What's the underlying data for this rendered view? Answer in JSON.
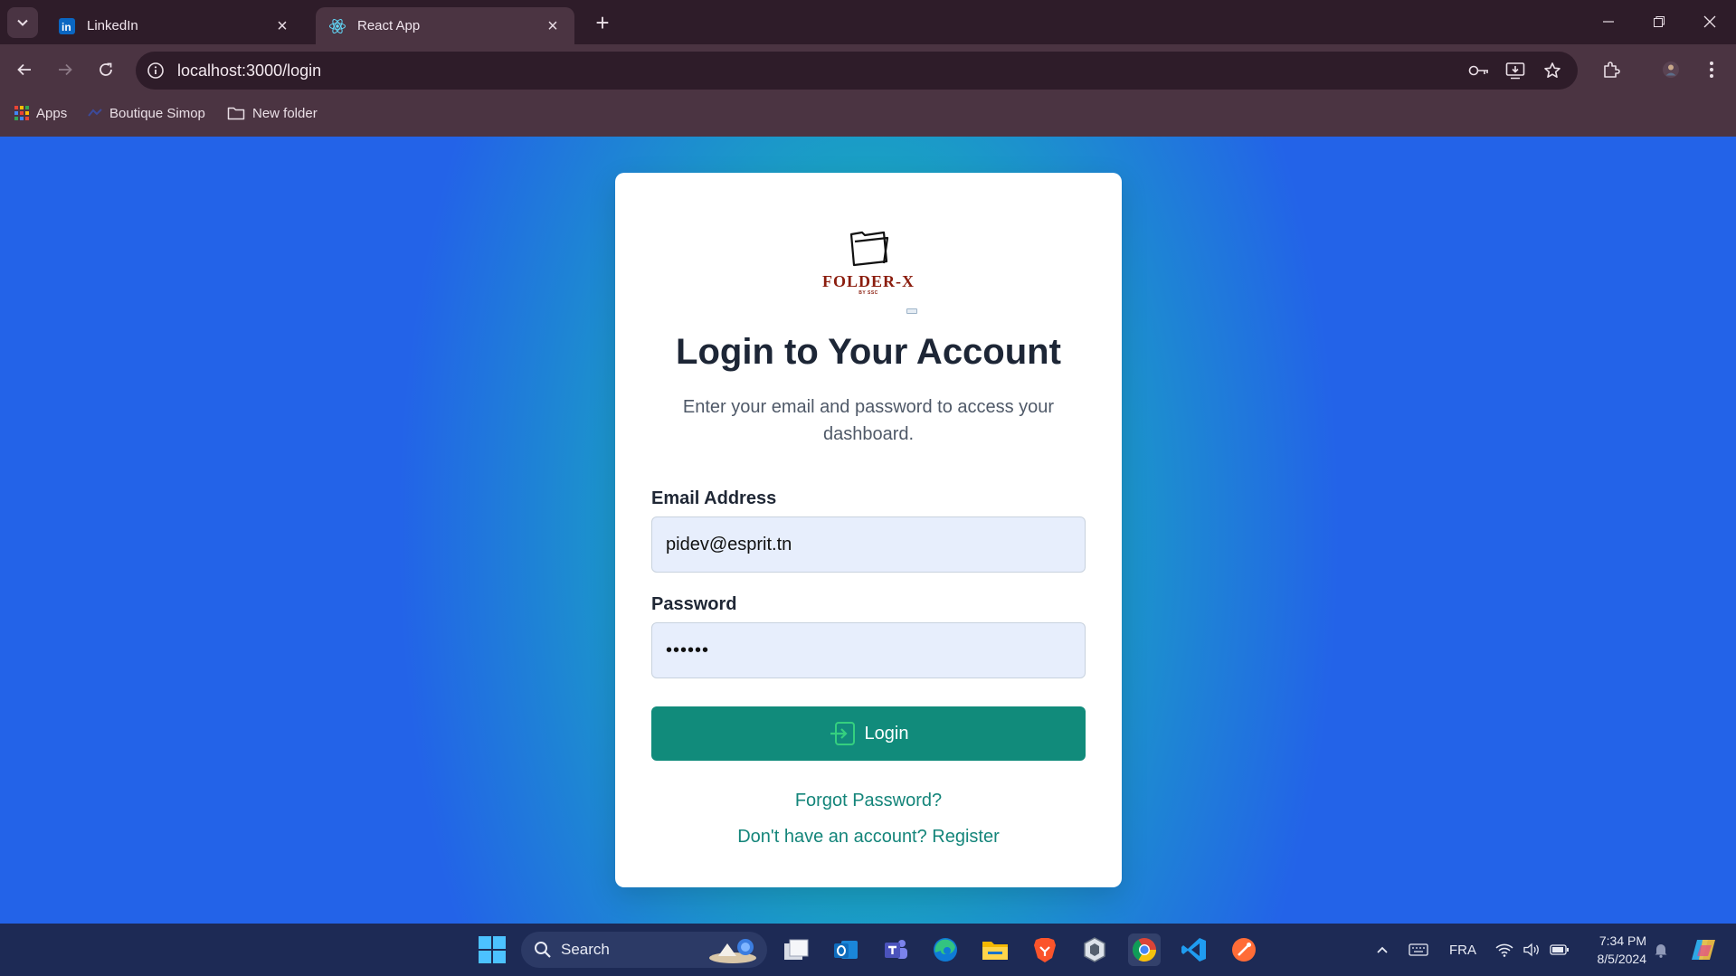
{
  "browser": {
    "tabs": [
      {
        "title": "LinkedIn",
        "icon": "linkedin-icon",
        "active": false
      },
      {
        "title": "React App",
        "icon": "react-icon",
        "active": true
      }
    ],
    "url": "localhost:3000/login",
    "bookmarks": [
      {
        "label": "Apps",
        "icon": "apps-grid-icon"
      },
      {
        "label": "Boutique Simop",
        "icon": "site-favicon-icon"
      },
      {
        "label": "New folder",
        "icon": "folder-icon"
      }
    ],
    "colors": {
      "tabstrip": "#2e1c29",
      "toolbar": "#4b3442"
    }
  },
  "login": {
    "logo_text": "FOLDER-X",
    "logo_subtext": "BY SSC",
    "title": "Login to Your Account",
    "subtitle": "Enter your email and password to access your dashboard.",
    "email_label": "Email Address",
    "email_value": "pidev@esprit.tn",
    "password_label": "Password",
    "password_value": "••••••",
    "login_button": "Login",
    "forgot_link": "Forgot Password?",
    "register_link": "Don't have an account? Register",
    "colors": {
      "button": "#118b7b",
      "link": "#14857a",
      "field_bg": "#e7eefc"
    }
  },
  "taskbar": {
    "search_label": "Search",
    "language": "FRA",
    "time": "7:34 PM",
    "date": "8/5/2024",
    "pinned": [
      "windows-start-icon",
      "task-view-icon",
      "outlook-icon",
      "teams-icon",
      "edge-icon",
      "file-explorer-icon",
      "brave-icon",
      "app-icon",
      "chrome-icon",
      "vscode-icon",
      "postman-icon"
    ]
  }
}
